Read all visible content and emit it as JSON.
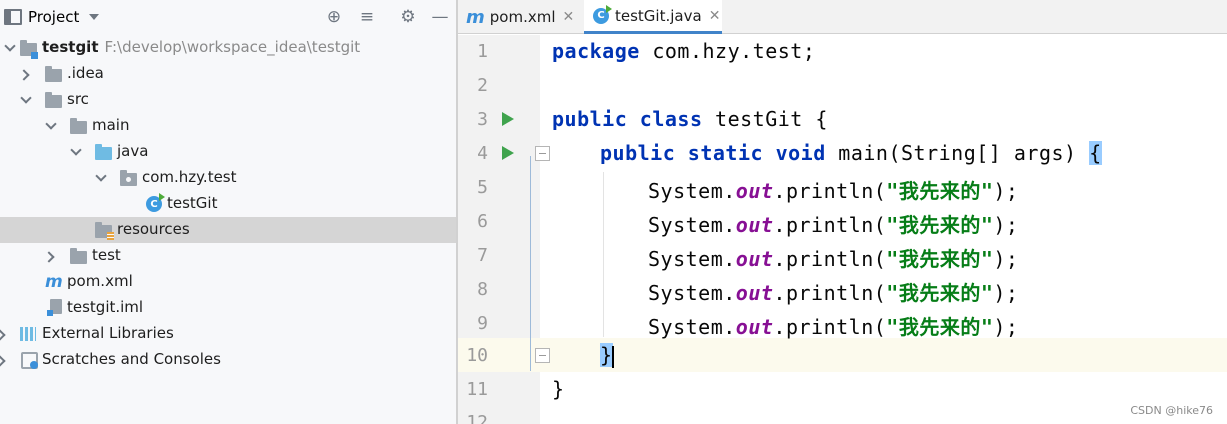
{
  "project_panel": {
    "title": "Project",
    "tree": [
      {
        "label": "testgit",
        "path": "F:\\develop\\workspace_idea\\testgit"
      },
      {
        "label": ".idea"
      },
      {
        "label": "src"
      },
      {
        "label": "main"
      },
      {
        "label": "java"
      },
      {
        "label": "com.hzy.test"
      },
      {
        "label": "testGit"
      },
      {
        "label": "resources"
      },
      {
        "label": "test"
      },
      {
        "label": "pom.xml"
      },
      {
        "label": "testgit.iml"
      },
      {
        "label": "External Libraries"
      },
      {
        "label": "Scratches and Consoles"
      }
    ]
  },
  "editor": {
    "tabs": [
      {
        "label": "pom.xml",
        "icon": "maven-m-icon",
        "active": false
      },
      {
        "label": "testGit.java",
        "icon": "java-class-icon",
        "active": true
      }
    ],
    "line_numbers": [
      "1",
      "2",
      "3",
      "4",
      "5",
      "6",
      "7",
      "8",
      "9",
      "10",
      "11",
      "12"
    ],
    "current_line": "10",
    "code": {
      "l1_kw": "package",
      "l1_rest": " com.hzy.test;",
      "l3_kw1": "public",
      "l3_kw2": "class",
      "l3_rest": " testGit {",
      "l4_kw1": "public",
      "l4_kw2": "static",
      "l4_kw3": "void",
      "l4_rest": " main(String[] args) ",
      "l4_brace": "{",
      "print_prefix": "System.",
      "print_field": "out",
      "print_call": ".println(",
      "print_string": "\"我先来的\"",
      "print_end": ");",
      "l10_brace": "}",
      "l11": "}"
    }
  },
  "watermark": "CSDN @hike76"
}
